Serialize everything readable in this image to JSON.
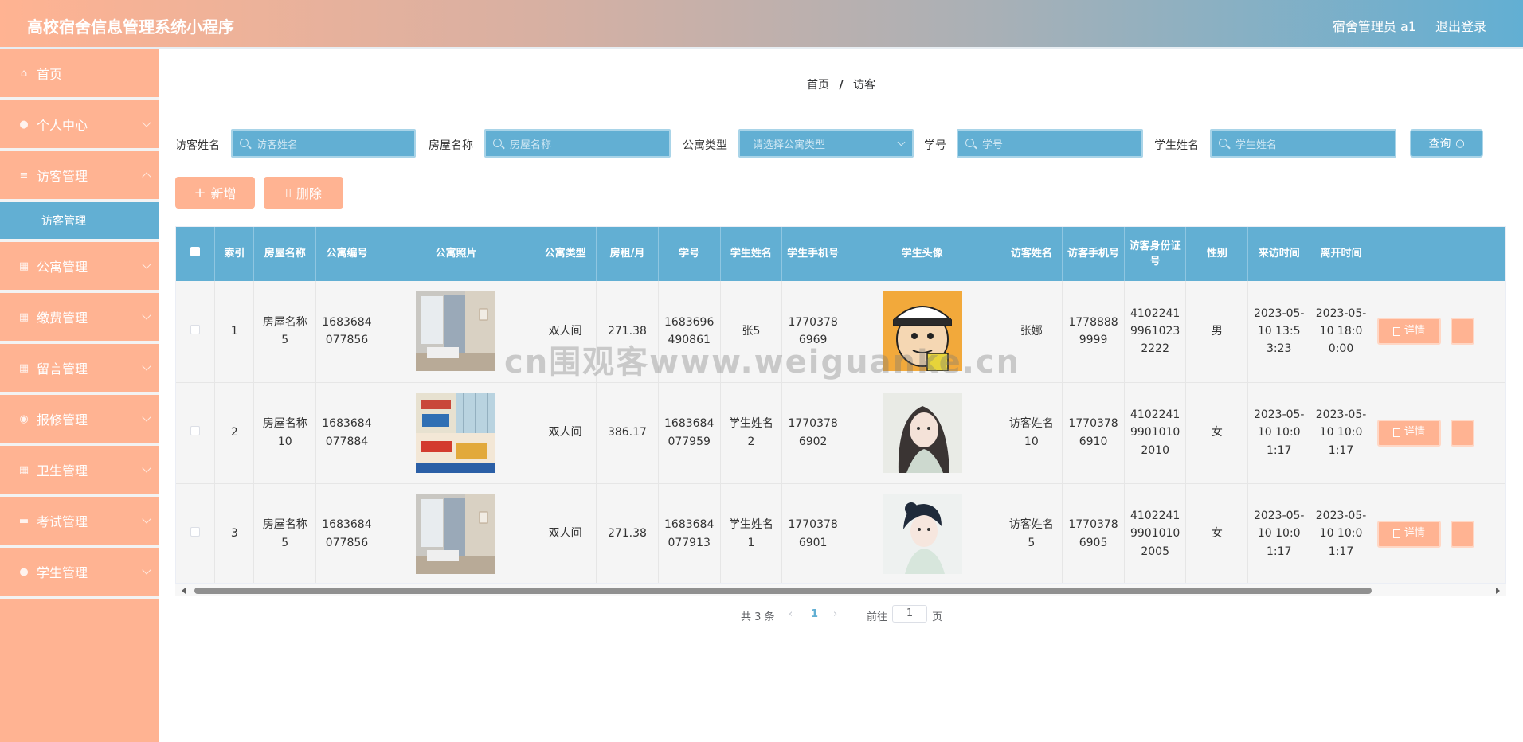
{
  "header": {
    "title": "高校宿舍信息管理系统小程序",
    "user_label": "宿舍管理员 a1",
    "logout": "退出登录"
  },
  "sidebar": {
    "items": [
      {
        "label": "首页",
        "icon": "home-icon"
      },
      {
        "label": "个人中心",
        "icon": "user-icon"
      },
      {
        "label": "访客管理",
        "icon": "list-icon"
      },
      {
        "label": "公寓管理",
        "icon": "building-icon"
      },
      {
        "label": "缴费管理",
        "icon": "grid-icon"
      },
      {
        "label": "留言管理",
        "icon": "grid-icon"
      },
      {
        "label": "报修管理",
        "icon": "pin-icon"
      },
      {
        "label": "卫生管理",
        "icon": "grid-icon"
      },
      {
        "label": "考试管理",
        "icon": "folder-icon"
      },
      {
        "label": "学生管理",
        "icon": "people-icon"
      }
    ],
    "active_sub": "访客管理"
  },
  "breadcrumb": {
    "home": "首页",
    "sep": "/",
    "current": "访客"
  },
  "search": {
    "visitor_name_label": "访客姓名",
    "visitor_name_placeholder": "访客姓名",
    "room_name_label": "房屋名称",
    "room_name_placeholder": "房屋名称",
    "apt_type_label": "公寓类型",
    "apt_type_placeholder": "请选择公寓类型",
    "student_no_label": "学号",
    "student_no_placeholder": "学号",
    "student_name_label": "学生姓名",
    "student_name_placeholder": "学生姓名",
    "query_button": "查询"
  },
  "actions": {
    "add": "新增",
    "delete": "删除"
  },
  "table": {
    "columns": [
      "索引",
      "房屋名称",
      "公寓编号",
      "公寓照片",
      "公寓类型",
      "房租/月",
      "学号",
      "学生姓名",
      "学生手机号",
      "学生头像",
      "访客姓名",
      "访客手机号",
      "访客身份证号",
      "性别",
      "来访时间",
      "离开时间"
    ],
    "rows": [
      {
        "index": "1",
        "room_name": "房屋名称5",
        "apt_no": "1683684077856",
        "apt_type": "双人间",
        "rent": "271.38",
        "student_no": "1683696490861",
        "student_name": "张5",
        "student_phone": "17703786969",
        "visitor_name": "张娜",
        "visitor_phone": "17788889999",
        "visitor_id": "410224199610232222",
        "gender": "男",
        "visit_time": "2023-05-10 13:53:23",
        "leave_time": "2023-05-10 18:00:00"
      },
      {
        "index": "2",
        "room_name": "房屋名称10",
        "apt_no": "1683684077884",
        "apt_type": "双人间",
        "rent": "386.17",
        "student_no": "1683684077959",
        "student_name": "学生姓名2",
        "student_phone": "17703786902",
        "visitor_name": "访客姓名10",
        "visitor_phone": "17703786910",
        "visitor_id": "410224199010102010",
        "gender": "女",
        "visit_time": "2023-05-10 10:01:17",
        "leave_time": "2023-05-10 10:01:17"
      },
      {
        "index": "3",
        "room_name": "房屋名称5",
        "apt_no": "1683684077856",
        "apt_type": "双人间",
        "rent": "271.38",
        "student_no": "1683684077913",
        "student_name": "学生姓名1",
        "student_phone": "17703786901",
        "visitor_name": "访客姓名5",
        "visitor_phone": "17703786905",
        "visitor_id": "410224199010102005",
        "gender": "女",
        "visit_time": "2023-05-10 10:01:17",
        "leave_time": "2023-05-10 10:01:17"
      }
    ],
    "detail_button": "详情"
  },
  "pagination": {
    "total": "共 3 条",
    "current_page": "1",
    "goto": "前往",
    "goto_value": "1",
    "page_unit": "页"
  },
  "watermark": "cn围观客www.weiguanke.cn",
  "colors": {
    "accent_orange": "#ffb392",
    "accent_blue": "#62afd3"
  }
}
